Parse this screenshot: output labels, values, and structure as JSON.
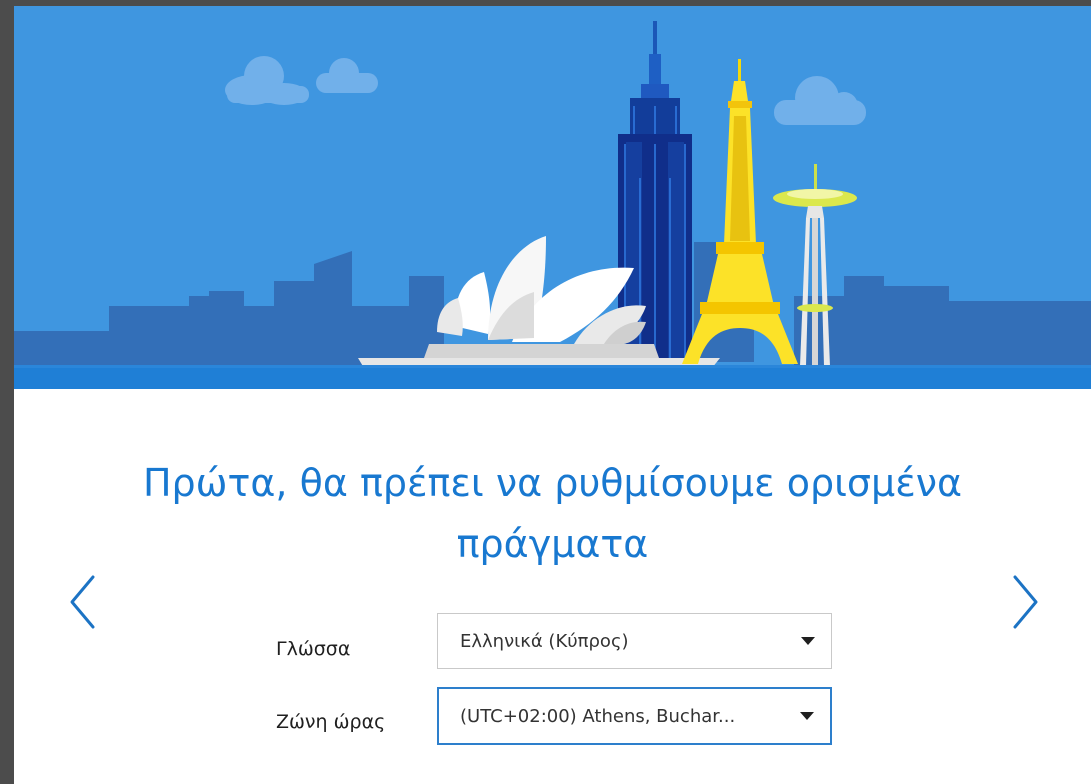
{
  "colors": {
    "accent": "#1878d0",
    "sky": "#3f96e0",
    "ground_band": "#1f7fd6",
    "skyline": "#336fb8",
    "focus_border": "#2d7fcc"
  },
  "hero": {
    "illustration": "city-landmarks"
  },
  "setup": {
    "title": "Πρώτα, θα πρέπει να ρυθμίσουμε ορισμένα πράγματα",
    "language_label": "Γλώσσα",
    "language_value": "Ελληνικά (Κύπρος)",
    "timezone_label": "Ζώνη ώρας",
    "timezone_value": "(UTC+02:00) Athens, Buchar..."
  },
  "navigation": {
    "back_icon": "chevron-left-icon",
    "next_icon": "chevron-right-icon"
  }
}
